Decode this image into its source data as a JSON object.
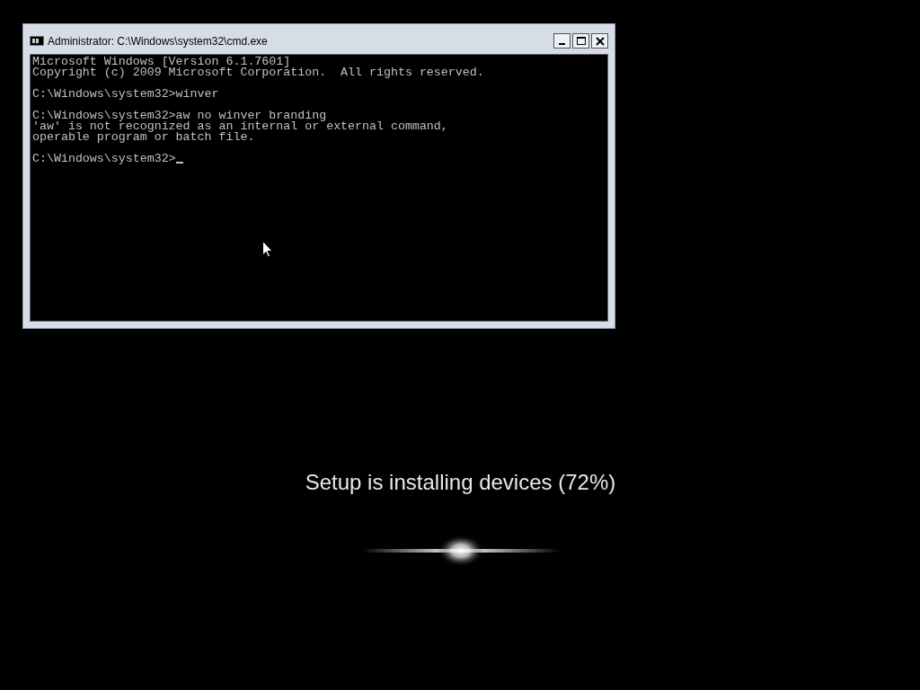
{
  "window": {
    "title": "Administrator: C:\\Windows\\system32\\cmd.exe"
  },
  "console": {
    "blocks": [
      [
        "Microsoft Windows [Version 6.1.7601]",
        "Copyright (c) 2009 Microsoft Corporation.  All rights reserved."
      ],
      [
        "C:\\Windows\\system32>winver"
      ],
      [
        "C:\\Windows\\system32>aw no winver branding",
        "'aw' is not recognized as an internal or external command,",
        "operable program or batch file."
      ],
      [
        "C:\\Windows\\system32>"
      ]
    ]
  },
  "setup": {
    "status": "Setup is installing devices (72%)"
  }
}
